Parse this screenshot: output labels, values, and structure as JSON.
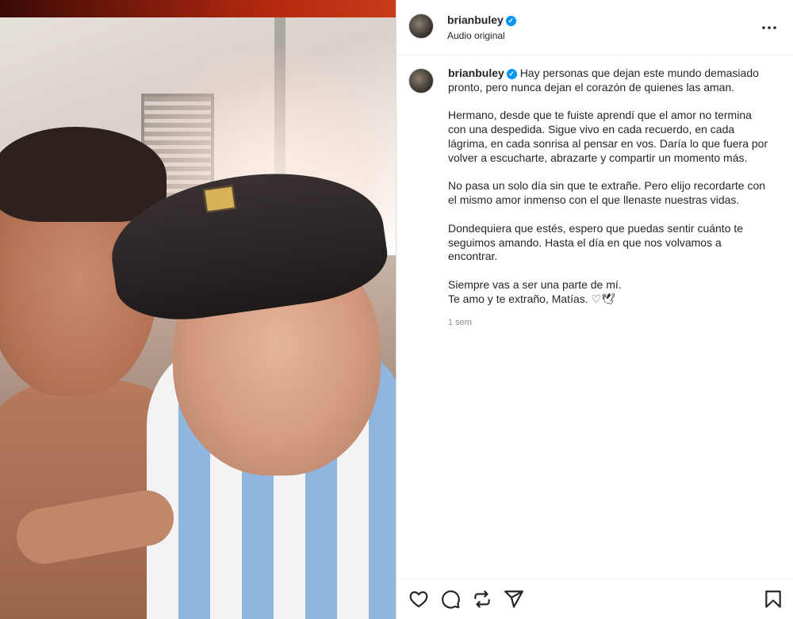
{
  "post": {
    "username": "brianbuley",
    "subtitle": "Audio original",
    "caption_paragraphs": [
      [
        "Hay personas que dejan este mundo demasiado",
        "pronto, pero nunca dejan el corazón de quienes las aman."
      ],
      [
        "Hermano, desde que te fuiste aprendí que el amor no termina",
        "con una despedida. Sigue vivo en cada recuerdo, en cada",
        "lágrima, en cada sonrisa al pensar en vos. Daría lo que fuera por",
        "volver a escucharte, abrazarte y compartir un momento más."
      ],
      [
        "No pasa un solo día sin que te extrañe. Pero elijo recordarte con",
        "el mismo amor inmenso con el que llenaste nuestras vidas."
      ],
      [
        "Dondequiera que estés, espero que puedas sentir cuánto te",
        "seguimos amando. Hasta el día en que nos volvamos a",
        "encontrar."
      ],
      [
        "Siempre vas a ser una parte de mí.",
        "Te amo y te extraño, Matías. ♡🕊"
      ]
    ],
    "timestamp": "1 sem"
  },
  "icons": {
    "more": "more-options-icon",
    "verified": "verified-badge-icon",
    "like": "heart-icon",
    "comment": "comment-icon",
    "repost": "repost-icon",
    "share": "share-icon",
    "save": "bookmark-icon"
  },
  "colors": {
    "verified": "#0095f6",
    "text": "#262626",
    "muted": "#8e8e8e"
  }
}
